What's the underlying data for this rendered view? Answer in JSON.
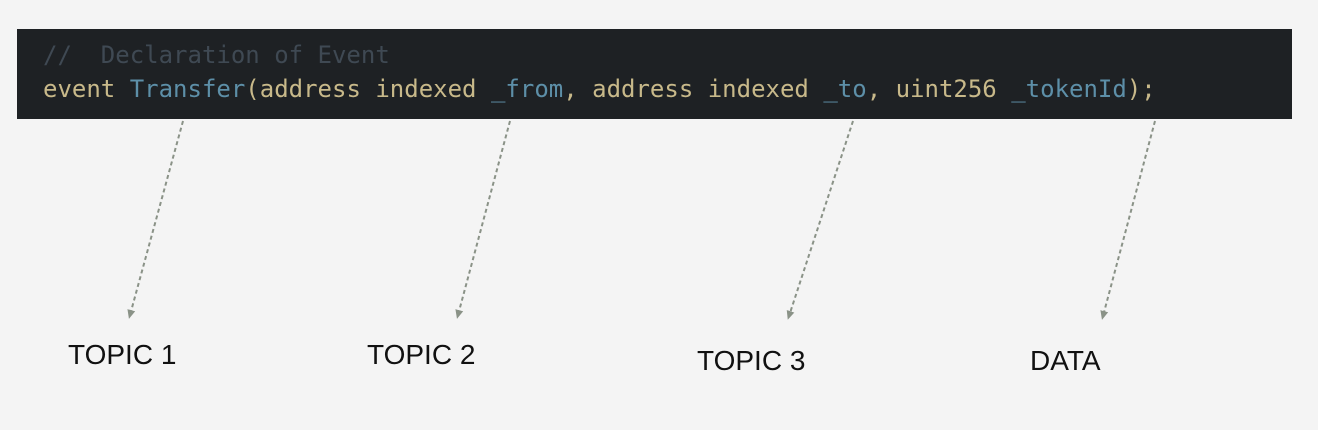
{
  "code": {
    "comment": "//  Declaration of Event",
    "keyword": "event",
    "event_name": "Transfer",
    "open_paren": "(",
    "type_1": "address",
    "modifier_1": "indexed",
    "param_1": "_from",
    "sep_1": ",",
    "type_2": "address",
    "modifier_2": "indexed",
    "param_2": "_to",
    "sep_2": ",",
    "type_3": "uint256",
    "param_3": "_tokenId",
    "close": ");"
  },
  "labels": {
    "topic_1": "TOPIC 1",
    "topic_2": "TOPIC 2",
    "topic_3": "TOPIC 3",
    "data": "DATA"
  },
  "colors": {
    "background": "#f4f4f4",
    "code_background": "#1e2124",
    "comment": "#3f4953",
    "keyword": "#c8b98a",
    "identifier": "#5d8fa8",
    "arrow": "#8a9287",
    "label_text": "#111111"
  }
}
